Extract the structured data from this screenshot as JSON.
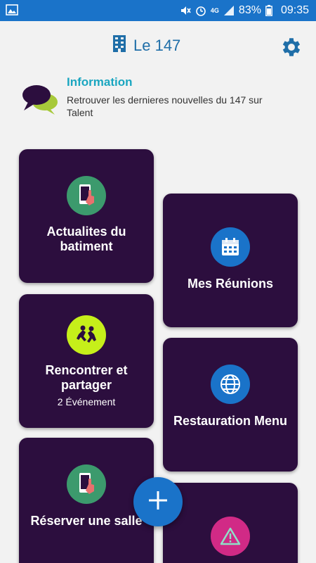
{
  "status_bar": {
    "battery": "83%",
    "time": "09:35",
    "network": "4G"
  },
  "header": {
    "title": "Le 147"
  },
  "info": {
    "title": "Information",
    "text": "Retrouver les dernieres nouvelles du 147 sur Talent"
  },
  "cards": {
    "actualites": {
      "label": "Actualites du batiment",
      "icon": "phone-tap-icon",
      "color": "#3c9a6d"
    },
    "reunions": {
      "label": "Mes Réunions",
      "icon": "calendar-icon",
      "color": "#1a73c9"
    },
    "rencontrer": {
      "label": "Rencontrer et partager",
      "sub": "2 Événement",
      "icon": "people-running-icon",
      "color": "#c6ef1a"
    },
    "restauration": {
      "label": "Restauration Menu",
      "icon": "globe-icon",
      "color": "#1a73c9"
    },
    "reserver": {
      "label": "Réserver une salle",
      "icon": "phone-tap-icon",
      "color": "#3c9a6d"
    },
    "alerte": {
      "icon": "warning-icon",
      "color": "#d12a86"
    }
  },
  "fab": {
    "icon": "plus-icon"
  },
  "colors": {
    "card_bg": "#2c0e3e",
    "accent": "#1a73c9",
    "info_title": "#1aa6c0"
  }
}
